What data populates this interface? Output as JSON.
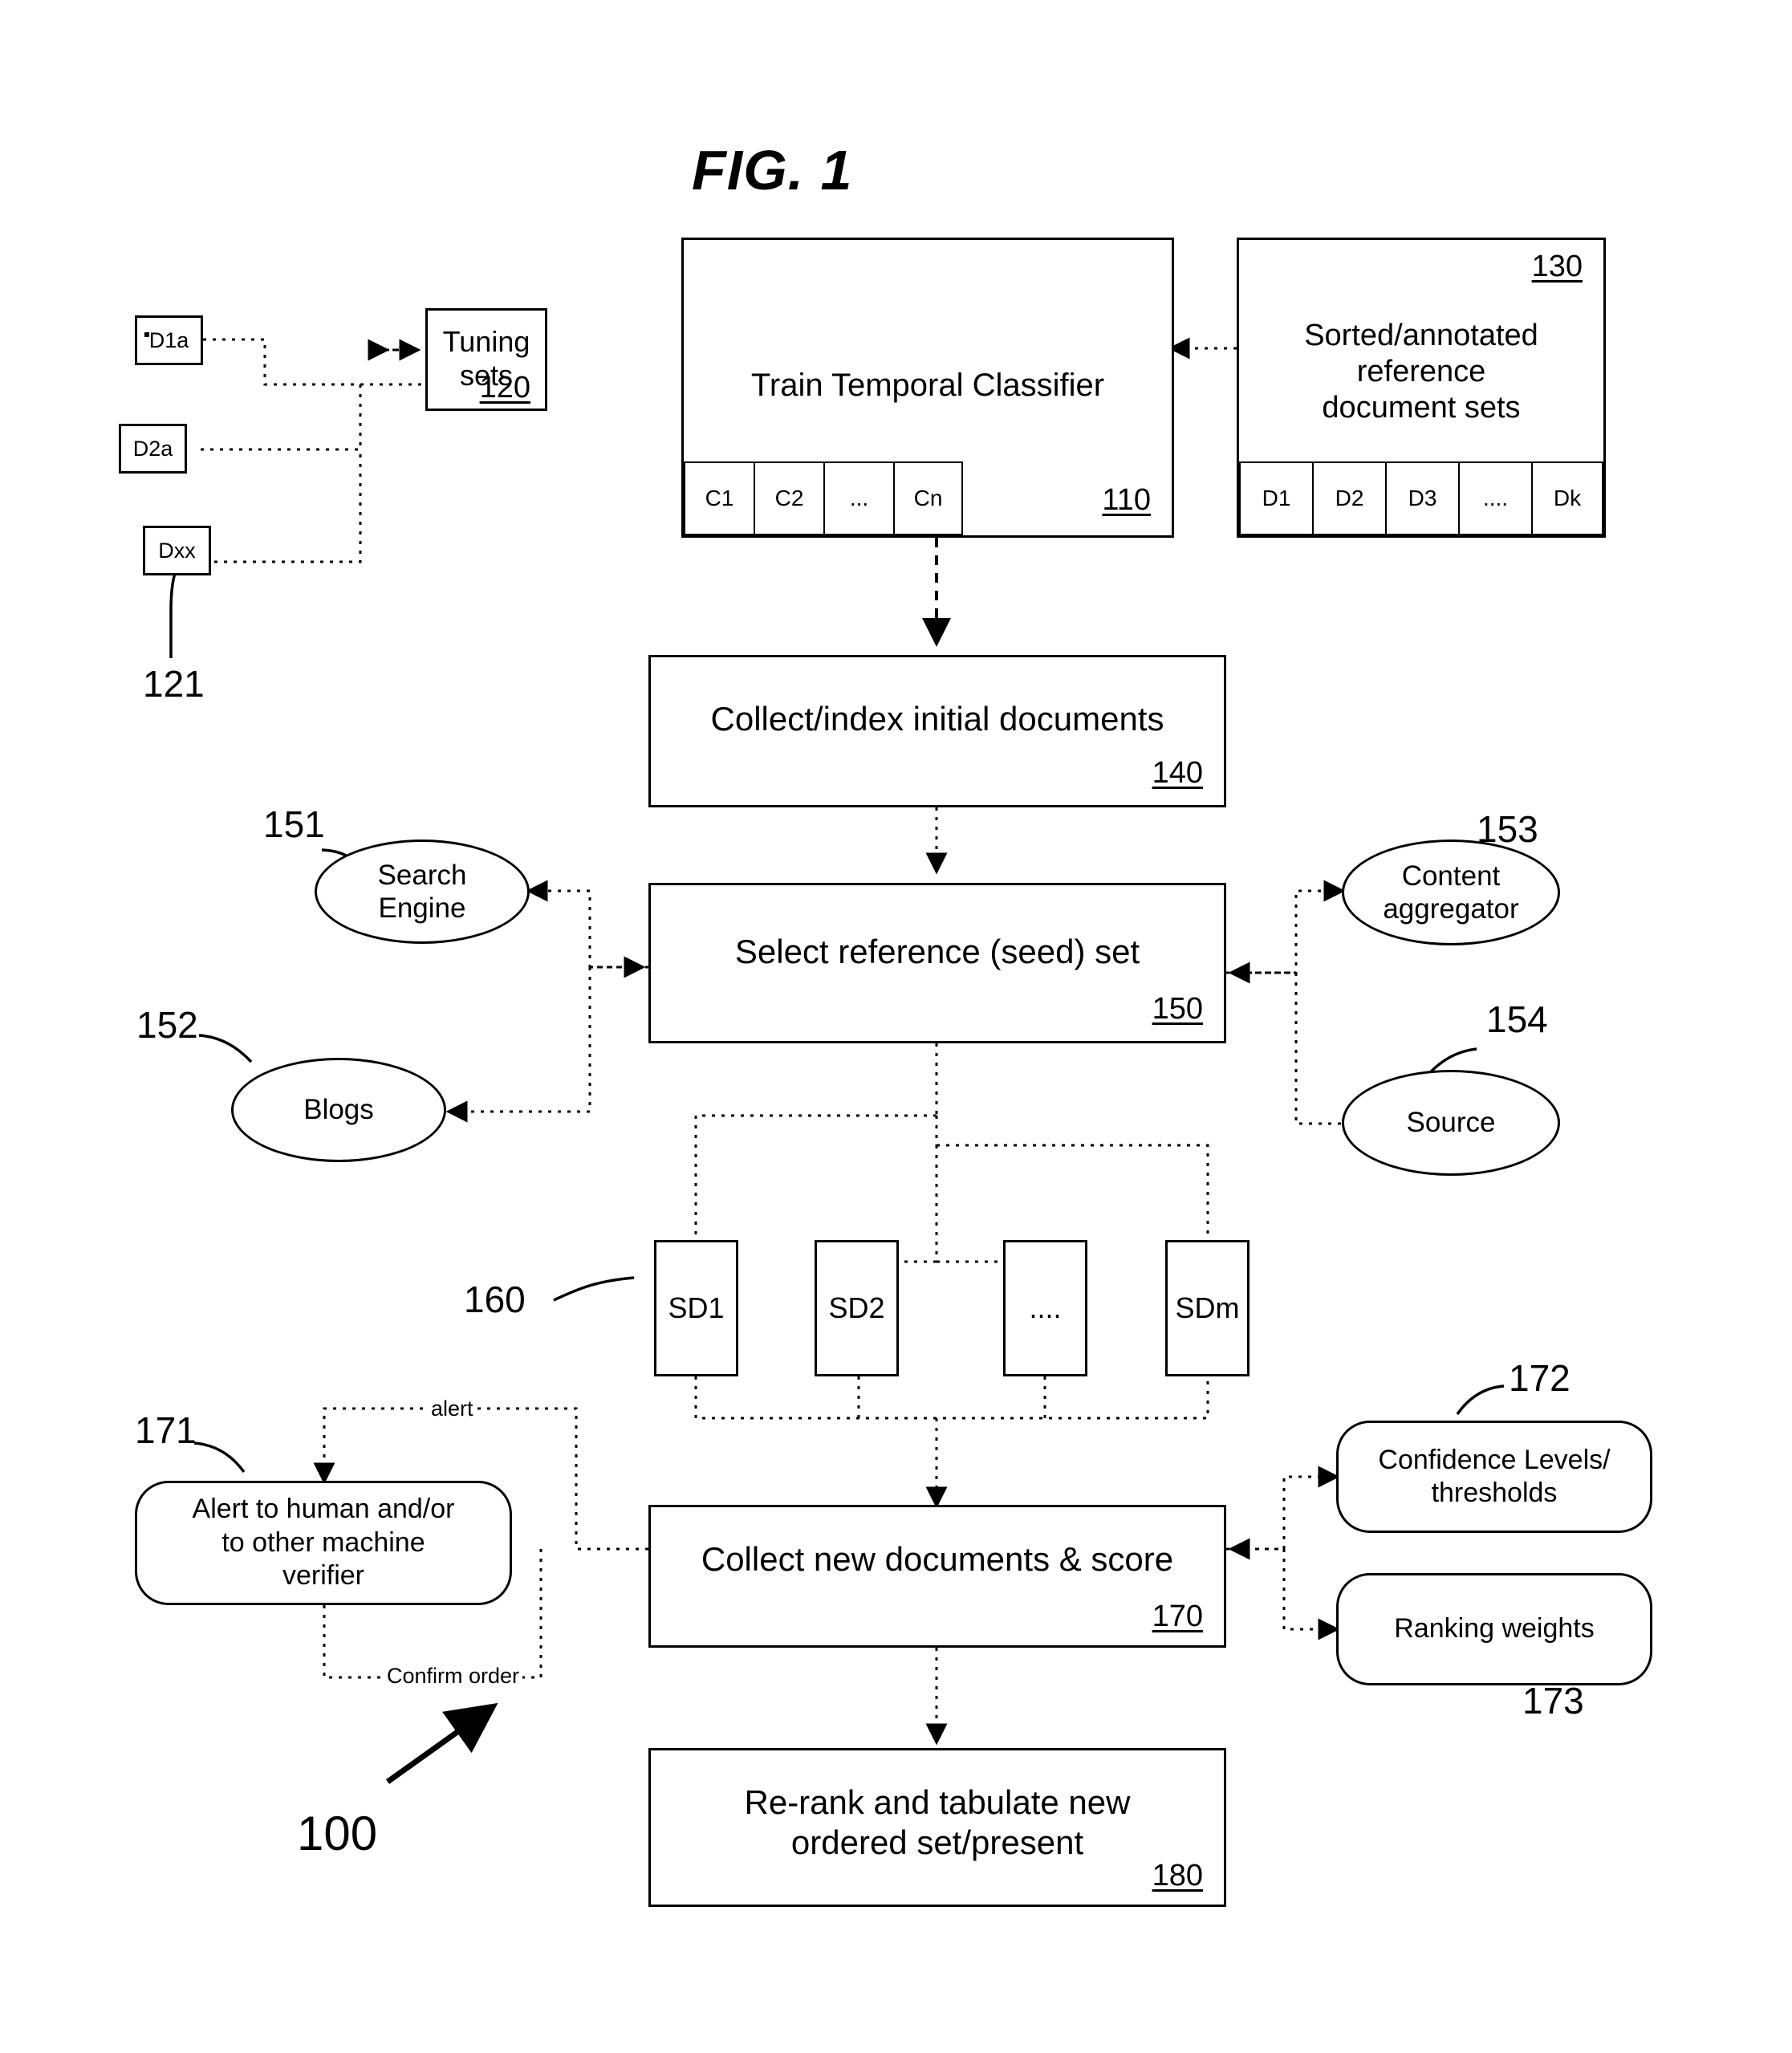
{
  "figure": {
    "title": "FIG. 1",
    "system_ref": "100"
  },
  "nodes": {
    "tuning_sets": {
      "label": "Tuning\nsets",
      "ref": "120"
    },
    "train_classifier": {
      "label": "Train Temporal Classifier",
      "ref": "110"
    },
    "sorted_reference": {
      "label": "Sorted/annotated\nreference\ndocument sets",
      "ref": "130"
    },
    "collect_index": {
      "label": "Collect/index initial documents",
      "ref": "140"
    },
    "select_seed": {
      "label": "Select reference (seed) set",
      "ref": "150"
    },
    "collect_score": {
      "label": "Collect new documents & score",
      "ref": "170"
    },
    "rerank": {
      "label": "Re-rank and tabulate new\nordered set/present",
      "ref": "180"
    },
    "alert_verifier": {
      "label": "Alert to human and/or\nto other machine\nverifier",
      "ref": "171"
    },
    "confidence": {
      "label": "Confidence Levels/\nthresholds",
      "ref": "172"
    },
    "ranking_weights": {
      "label": "Ranking weights",
      "ref": "173"
    },
    "search_engine": {
      "label": "Search\nEngine",
      "ref": "151"
    },
    "blogs": {
      "label": "Blogs",
      "ref": "152"
    },
    "content_aggregator": {
      "label": "Content\naggregator",
      "ref": "153"
    },
    "source": {
      "label": "Source",
      "ref": "154"
    }
  },
  "tuning_documents": {
    "ref": "121",
    "items": [
      {
        "label": "D1a"
      },
      {
        "label": "D2a"
      },
      {
        "label": "Dxx"
      }
    ]
  },
  "classifier_cells": {
    "items": [
      "C1",
      "C2",
      "...",
      "Cn"
    ]
  },
  "reference_cells": {
    "items": [
      "D1",
      "D2",
      "D3",
      "....",
      "Dk"
    ]
  },
  "seed_documents": {
    "ref": "160",
    "items": [
      "SD1",
      "SD2",
      "....",
      "SDm"
    ]
  },
  "edge_labels": {
    "alert": "alert",
    "confirm_order": "Confirm order"
  }
}
